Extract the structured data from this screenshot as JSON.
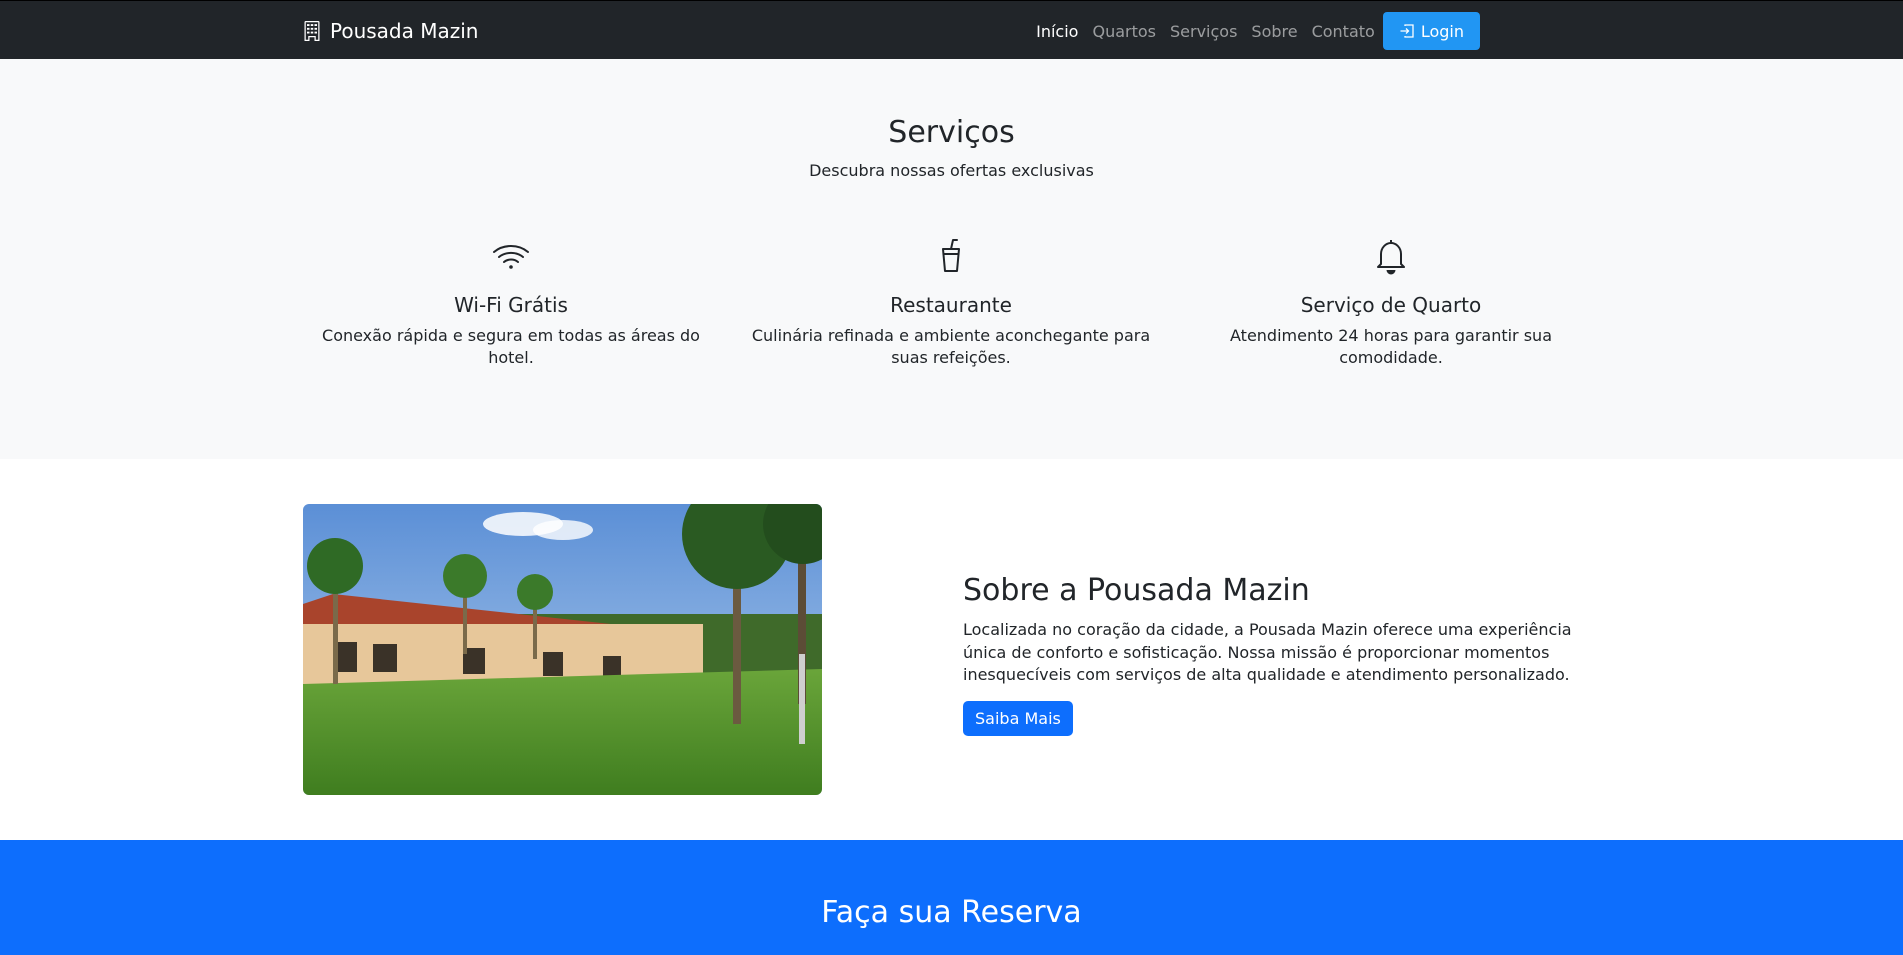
{
  "navbar": {
    "brand": "Pousada Mazin",
    "brand_icon": "building-icon",
    "links": [
      "Início",
      "Quartos",
      "Serviços",
      "Sobre",
      "Contato"
    ],
    "login_label": "Login",
    "login_icon": "box-arrow-in-right-icon",
    "bg_color": "#212529",
    "login_color": "#2196f3"
  },
  "services": {
    "title": "Serviços",
    "subtitle": "Descubra nossas ofertas exclusivas",
    "items": [
      {
        "icon": "wifi-icon",
        "title": "Wi-Fi Grátis",
        "text": "Conexão rápida e segura em todas as áreas do hotel."
      },
      {
        "icon": "cup-straw-icon",
        "title": "Restaurante",
        "text": "Culinária refinada e ambiente aconchegante para suas refeições."
      },
      {
        "icon": "bell-icon",
        "title": "Serviço de Quarto",
        "text": "Atendimento 24 horas para garantir sua comodidade."
      }
    ]
  },
  "about": {
    "title": "Sobre a Pousada Mazin",
    "text": "Localizada no coração da cidade, a Pousada Mazin oferece uma experiência única de conforto e sofisticação. Nossa missão é proporcionar momentos inesquecíveis com serviços de alta qualidade e atendimento personalizado.",
    "button": "Saiba Mais",
    "accent_color": "#0d6efd"
  },
  "reserva": {
    "title": "Faça sua Reserva",
    "bg_color": "#0d6efd"
  }
}
